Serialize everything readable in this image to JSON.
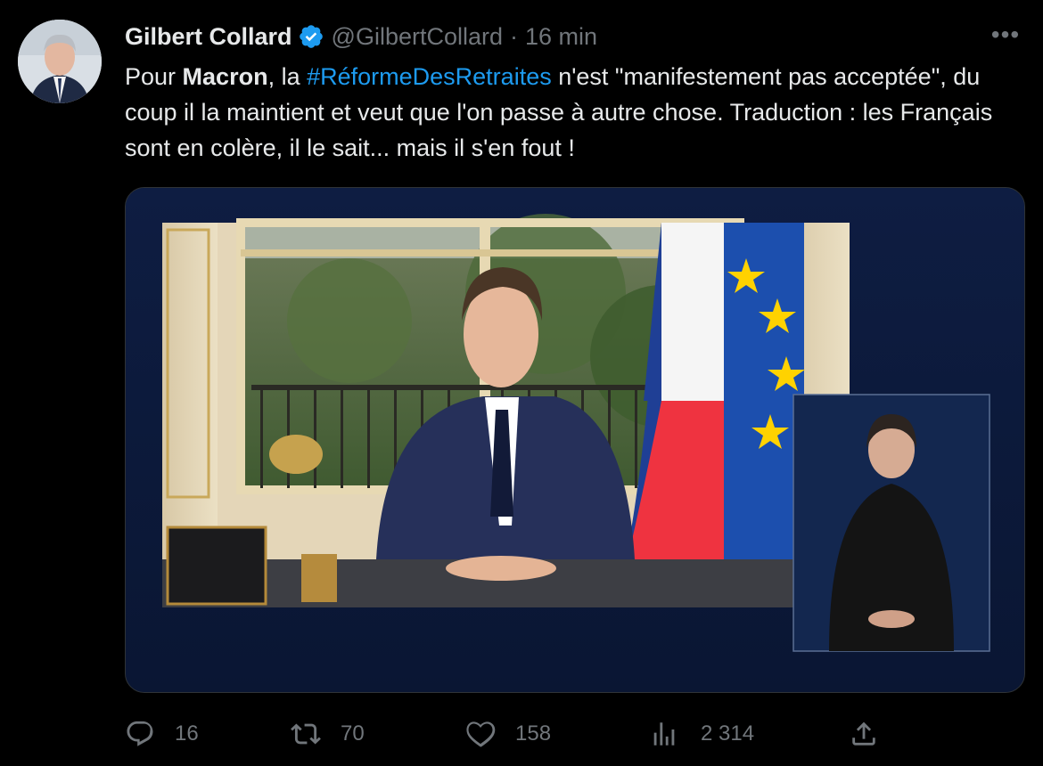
{
  "tweet": {
    "author_name": "Gilbert Collard",
    "handle": "@GilbertCollard",
    "separator": "·",
    "time": "16 min",
    "more_label": "•••",
    "text": {
      "seg1": "Pour ",
      "bold": "Macron",
      "seg2": ", la ",
      "hashtag": "#RéformeDesRetraites",
      "seg3": " n'est \"manifestement pas acceptée\", du coup il la maintient et veut que l'on passe à autre chose. Traduction : les Français sont en colère, il le sait... mais il s'en fout !"
    }
  },
  "actions": {
    "replies": "16",
    "retweets": "70",
    "likes": "158",
    "views": "2 314"
  },
  "icons": {
    "verified": "verified-badge-icon",
    "reply": "reply-icon",
    "retweet": "retweet-icon",
    "like": "heart-icon",
    "views": "views-icon",
    "share": "share-icon",
    "more": "more-icon"
  },
  "colors": {
    "background": "#000000",
    "text": "#e7e9ea",
    "muted": "#71767b",
    "accent": "#1d9bf0",
    "media_frame": "#0d1b3c"
  }
}
